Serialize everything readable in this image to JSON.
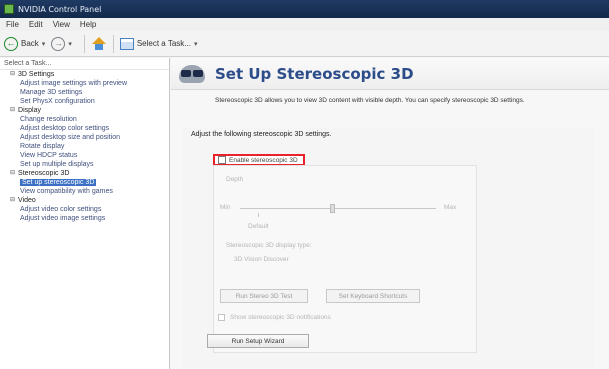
{
  "window": {
    "title": "NVIDIA Control Panel"
  },
  "menu": [
    "File",
    "Edit",
    "View",
    "Help"
  ],
  "toolbar": {
    "back": "Back",
    "tasks": "Select a Task..."
  },
  "left_panel": {
    "header": "Select a Task...",
    "categories": [
      {
        "label": "3D Settings",
        "items": [
          "Adjust image settings with preview",
          "Manage 3D settings",
          "Set PhysX configuration"
        ]
      },
      {
        "label": "Display",
        "items": [
          "Change resolution",
          "Adjust desktop color settings",
          "Adjust desktop size and position",
          "Rotate display",
          "View HDCP status",
          "Set up multiple displays"
        ]
      },
      {
        "label": "Stereoscopic 3D",
        "items": [
          "Set up stereoscopic 3D",
          "View compatibility with games"
        ]
      },
      {
        "label": "Video",
        "items": [
          "Adjust video color settings",
          "Adjust video image settings"
        ]
      }
    ],
    "selected_item": "Set up stereoscopic 3D"
  },
  "main": {
    "title": "Set Up Stereoscopic 3D",
    "description": "Stereoscopic 3D allows you to view 3D content with visible depth. You can specify stereoscopic 3D settings.",
    "panel_title": "Adjust the following stereoscopic 3D settings.",
    "enable_label": "Enable stereoscopic 3D",
    "depth_label": "Depth",
    "depth_min": "Min",
    "depth_max": "Max",
    "depth_default": "Default",
    "stereo_type_label": "Stereoscopic 3D display type:",
    "stereo_type_value": "3D Vision Discover",
    "btn_test": "Run Stereo 3D Test",
    "btn_keyboard": "Set Keyboard Shortcuts",
    "notify_label": "Show stereoscopic 3D notifications",
    "wizard": "Run Setup Wizard"
  },
  "colors": {
    "title_bar": "#1f3a63",
    "highlight": "#e8232b",
    "selected": "#3b70c4",
    "heading": "#2c4c8a"
  },
  "icons": [
    "nvidia-icon",
    "back-icon",
    "forward-icon",
    "home-icon",
    "tasks-icon",
    "stereo-glasses-icon"
  ]
}
